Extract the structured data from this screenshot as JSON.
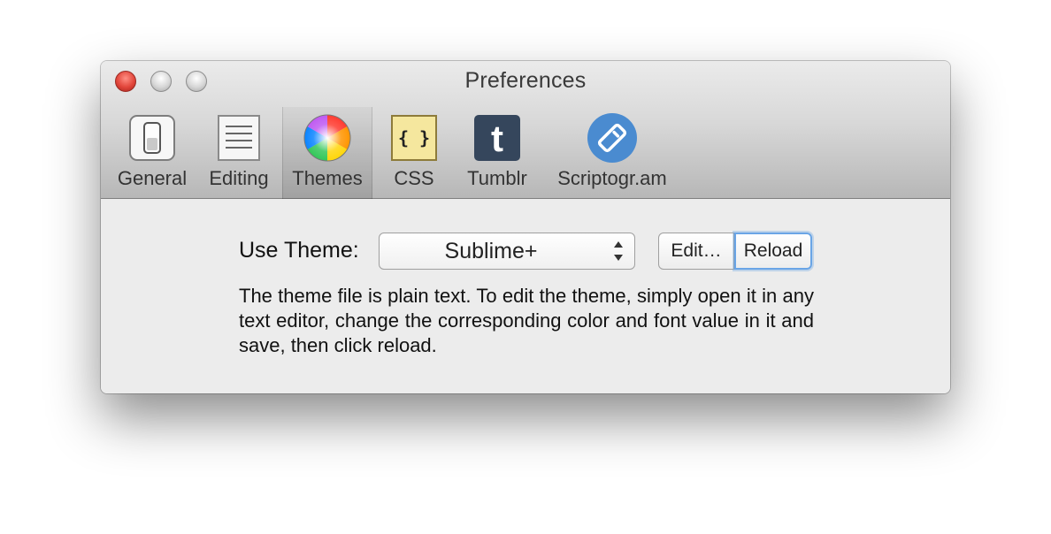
{
  "window": {
    "title": "Preferences"
  },
  "toolbar": {
    "items": [
      {
        "label": "General",
        "icon": "general-switch-icon"
      },
      {
        "label": "Editing",
        "icon": "editing-document-icon"
      },
      {
        "label": "Themes",
        "icon": "color-wheel-icon",
        "selected": true
      },
      {
        "label": "CSS",
        "icon": "css-braces-icon"
      },
      {
        "label": "Tumblr",
        "icon": "tumblr-icon"
      },
      {
        "label": "Scriptogr.am",
        "icon": "scriptogram-icon"
      }
    ]
  },
  "theme_settings": {
    "use_theme_label": "Use Theme:",
    "selected_theme": "Sublime+",
    "edit_button": "Edit…",
    "reload_button": "Reload",
    "description": "The theme file is plain text. To edit the theme, simply open it in any text editor, change the corresponding color and font value in it and save, then click reload."
  },
  "colors": {
    "close_button": "#e2463b",
    "focus_ring": "#6aa5e6",
    "tumblr_blue": "#35465c",
    "scriptogram_blue": "#4a8bd0",
    "css_yellow": "#f5e79e"
  }
}
